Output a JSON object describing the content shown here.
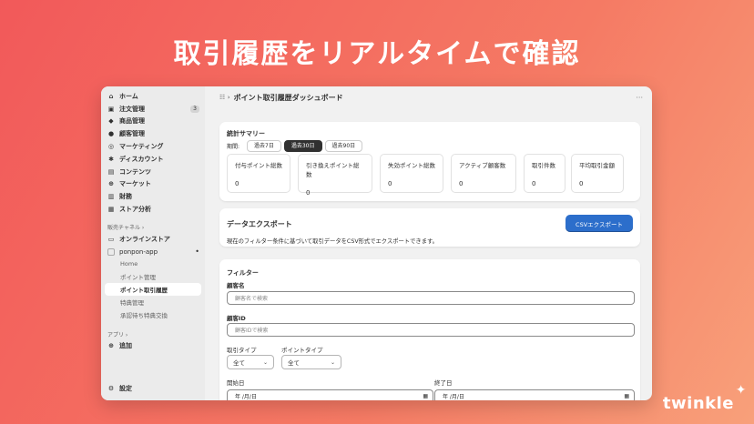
{
  "headline": "取引履歴をリアルタイムで確認",
  "brand": {
    "name": "twinkle",
    "accent": "#ffffff"
  },
  "sidebar": {
    "items": [
      {
        "icon": "home-icon",
        "glyph": "⌂",
        "label": "ホーム"
      },
      {
        "icon": "orders-icon",
        "glyph": "▣",
        "label": "注文管理",
        "badge": "3"
      },
      {
        "icon": "tag-icon",
        "glyph": "◆",
        "label": "商品管理"
      },
      {
        "icon": "person-icon",
        "glyph": "●",
        "label": "顧客管理"
      },
      {
        "icon": "target-icon",
        "glyph": "◎",
        "label": "マーケティング"
      },
      {
        "icon": "discount-icon",
        "glyph": "✱",
        "label": "ディスカウント"
      },
      {
        "icon": "content-icon",
        "glyph": "▤",
        "label": "コンテンツ"
      },
      {
        "icon": "globe-icon",
        "glyph": "⊕",
        "label": "マーケット"
      },
      {
        "icon": "bank-icon",
        "glyph": "▥",
        "label": "財務"
      },
      {
        "icon": "chart-icon",
        "glyph": "▦",
        "label": "ストア分析"
      }
    ],
    "sales_channels_title": "販売チャネル ›",
    "online_store": {
      "icon": "store-icon",
      "glyph": "▭",
      "label": "オンラインストア"
    },
    "app": {
      "name": "ponpon-app",
      "dot": "•"
    },
    "app_subitems": [
      "Home",
      "ポイント管理",
      "ポイント取引履歴",
      "特典管理",
      "承認待ち特典交換"
    ],
    "active_subitem": "ポイント取引履歴",
    "apps_title": "アプリ ›",
    "add_item": {
      "glyph": "⊕",
      "label": "追加"
    },
    "settings": {
      "glyph": "⚙",
      "label": "設定"
    }
  },
  "topbar": {
    "title": "ポイント取引履歴ダッシュボード",
    "crumb_glyph": "☷ ›",
    "more": "···"
  },
  "summary": {
    "title": "統計サマリー",
    "period_label": "期間:",
    "periods": [
      "過去7日",
      "過去30日",
      "過去90日"
    ],
    "active_period": "過去30日",
    "stats": [
      {
        "label": "付与ポイント総数",
        "value": "0"
      },
      {
        "label": "引き換えポイント総数",
        "value": "0"
      },
      {
        "label": "失効ポイント総数",
        "value": "0"
      },
      {
        "label": "アクティブ顧客数",
        "value": "0"
      },
      {
        "label": "取引件数",
        "value": "0"
      },
      {
        "label": "平均取引金額",
        "value": "0"
      }
    ]
  },
  "export": {
    "title": "データエクスポート",
    "description": "現在のフィルター条件に基づいて取引データをCSV形式でエクスポートできます。",
    "button": "CSVエクスポート",
    "button_color": "#2c6ecb"
  },
  "filter": {
    "title": "フィルター",
    "customer_name_label": "顧客名",
    "customer_name_placeholder": "顧客名で検索",
    "customer_id_label": "顧客ID",
    "customer_id_placeholder": "顧客IDで検索",
    "transaction_type_label": "取引タイプ",
    "transaction_type_value": "全て",
    "point_type_label": "ポイントタイプ",
    "point_type_value": "全て",
    "start_date_label": "開始日",
    "start_date_value": "年 /月/日",
    "end_date_label": "終了日",
    "end_date_value": "年 /月/日"
  }
}
